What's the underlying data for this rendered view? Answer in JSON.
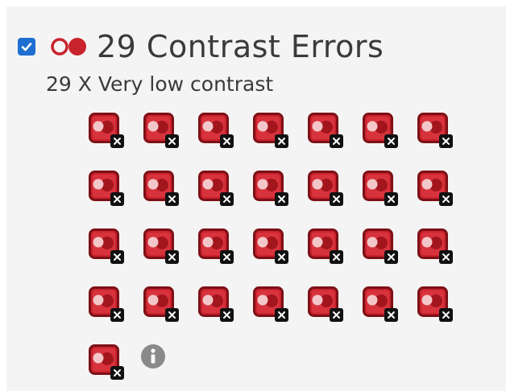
{
  "header": {
    "checkbox_checked": true,
    "icon": "contrast-errors-icon",
    "title": "29 Contrast Errors"
  },
  "subtitle": "29 X Very low contrast",
  "errors": {
    "count": 29,
    "item_icon": "contrast-error-icon",
    "badge_icon": "close-icon"
  },
  "info_icon": "info-icon",
  "colors": {
    "accent": "#1f6fd1",
    "error_red": "#c9232e",
    "error_red_dark": "#7d1016",
    "info_gray": "#8a8a8a",
    "panel_bg": "#f4f4f4"
  }
}
